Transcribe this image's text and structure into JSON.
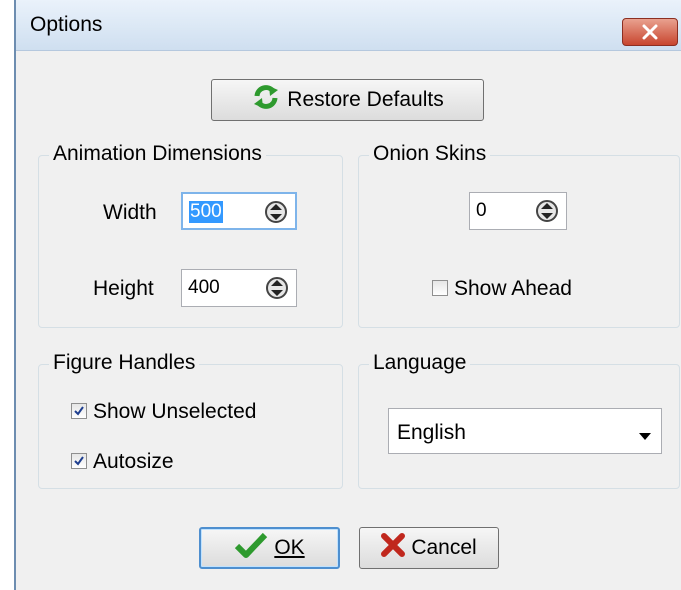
{
  "window": {
    "title": "Options"
  },
  "buttons": {
    "restore_defaults": "Restore Defaults",
    "ok": "OK",
    "cancel": "Cancel"
  },
  "animation_dimensions": {
    "title": "Animation Dimensions",
    "width_label": "Width",
    "width_value": "500",
    "height_label": "Height",
    "height_value": "400"
  },
  "onion_skins": {
    "title": "Onion Skins",
    "count_value": "0",
    "show_ahead_label": "Show Ahead",
    "show_ahead_checked": false
  },
  "figure_handles": {
    "title": "Figure Handles",
    "show_unselected_label": "Show Unselected",
    "show_unselected_checked": true,
    "autosize_label": "Autosize",
    "autosize_checked": true
  },
  "language": {
    "title": "Language",
    "selected": "English"
  },
  "colors": {
    "close_button": "#c8462f",
    "restore_icon": "#2e9a2e",
    "ok_check": "#2e9a2e",
    "cancel_x": "#c0271d"
  },
  "icons": {
    "close": "close-x-icon",
    "restore": "refresh-icon",
    "ok": "checkmark-icon",
    "cancel": "x-icon"
  }
}
